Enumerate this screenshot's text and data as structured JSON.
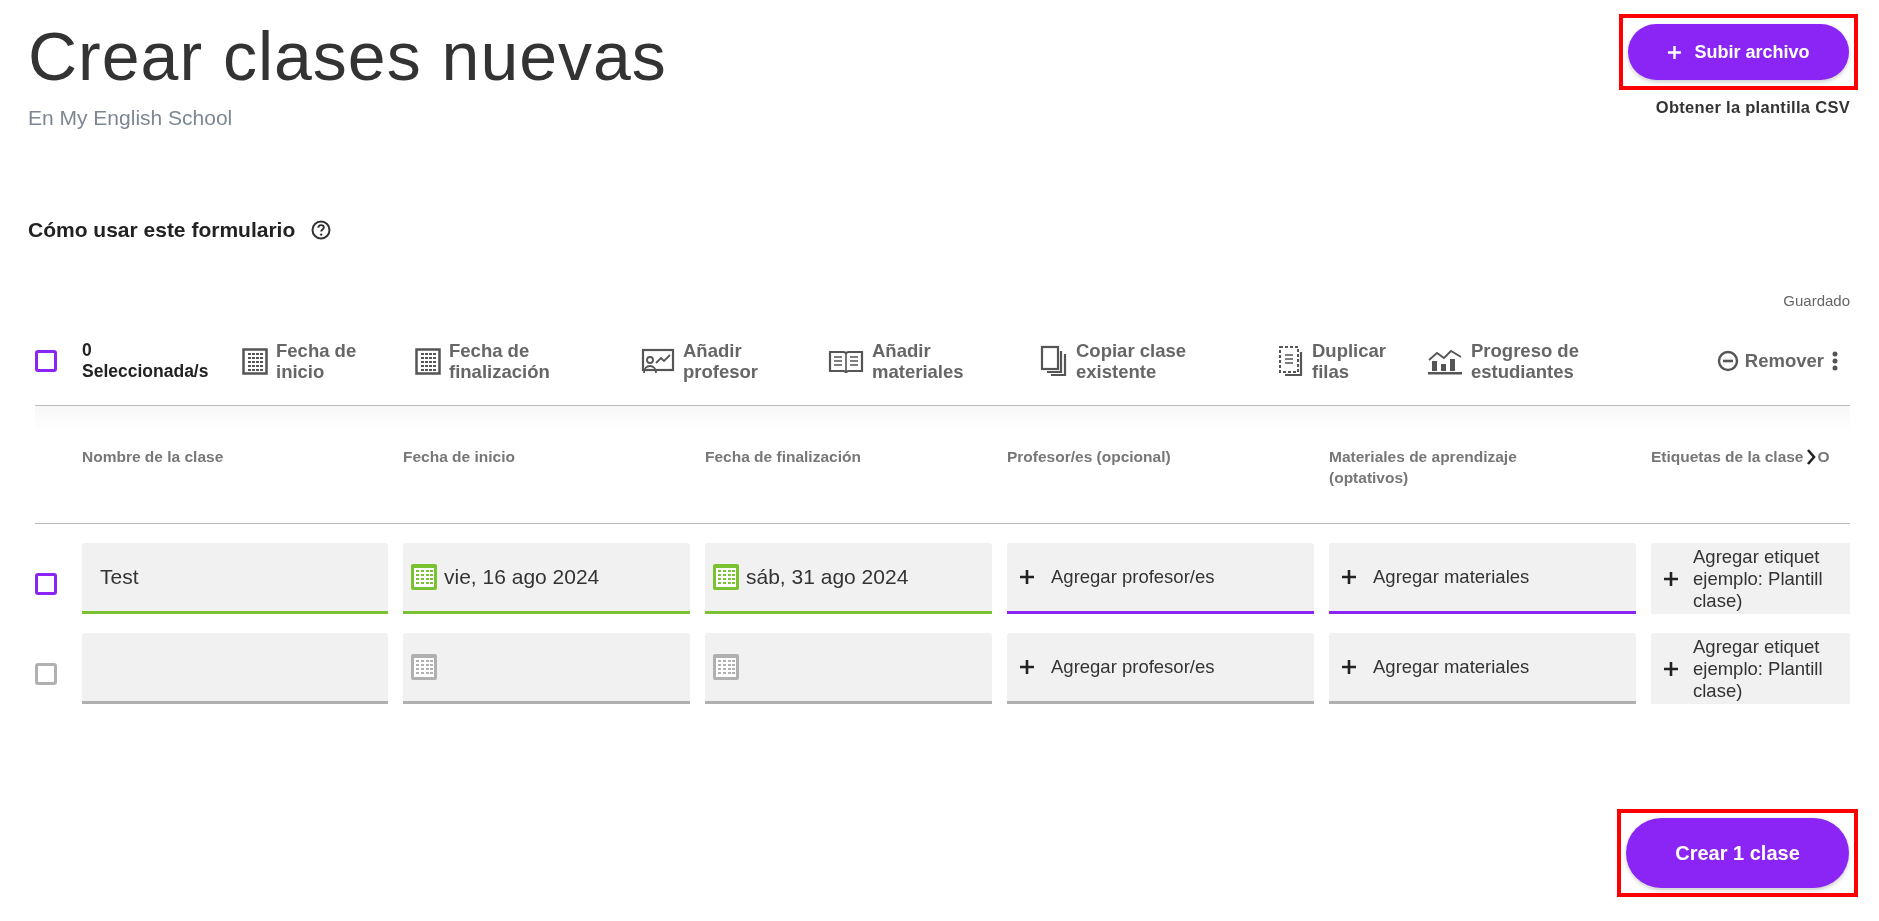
{
  "header": {
    "title": "Crear clases nuevas",
    "subtitle": "En My English School"
  },
  "upload": {
    "label": "Subir archivo",
    "highlighted": true,
    "template_link": "Obtener la plantilla CSV"
  },
  "help": {
    "label": "Cómo usar este formulario"
  },
  "save_status": "Guardado",
  "toolbar": {
    "select_all": {
      "checked": false
    },
    "count_lines": [
      "0",
      "Seleccionada/s"
    ],
    "actions": [
      {
        "kind": "calendar",
        "lines": [
          "Fecha de",
          "inicio"
        ]
      },
      {
        "kind": "calendar",
        "lines": [
          "Fecha de",
          "finalización"
        ]
      },
      {
        "kind": "teacher",
        "lines": [
          "Añadir",
          "profesor"
        ]
      },
      {
        "kind": "book",
        "lines": [
          "Añadir",
          "materiales"
        ]
      },
      {
        "kind": "copy",
        "lines": [
          "Copiar clase",
          "existente"
        ]
      },
      {
        "kind": "duplicate",
        "lines": [
          "Duplicar",
          "filas"
        ]
      },
      {
        "kind": "chart",
        "lines": [
          "Progreso de",
          "estudiantes"
        ]
      }
    ],
    "remove": {
      "label": "Remover"
    }
  },
  "table": {
    "columns": [
      "Nombre de la clase",
      "Fecha de inicio",
      "Fecha de finalización",
      "Profesor/es (opcional)",
      "Materiales de aprendizaje (optativos)",
      "Etiquetas de la clase",
      "O"
    ],
    "rows": [
      {
        "color": "#8a25f5",
        "checked": false,
        "name": {
          "value": "Test",
          "valid": true
        },
        "start": {
          "value": "vie, 16 ago 2024",
          "valid": true
        },
        "end": {
          "value": "sáb, 31 ago 2024",
          "valid": true
        },
        "teachers": {
          "label": "Agregar profesor/es",
          "focused": true
        },
        "materials": {
          "label": "Agregar materiales",
          "focused": true
        },
        "tags": {
          "lines": [
            "Agregar etiquet",
            "ejemplo: Plantill",
            "clase)"
          ]
        }
      },
      {
        "color": "#b0b0b0",
        "checked": false,
        "name": {
          "valid": false
        },
        "start": {
          "valid": false
        },
        "end": {
          "valid": false
        },
        "teachers": {
          "label": "Agregar profesor/es",
          "focused": false
        },
        "materials": {
          "label": "Agregar materiales",
          "focused": false
        },
        "tags": {
          "lines": [
            "Agregar etiquet",
            "ejemplo: Plantill",
            "clase)"
          ]
        }
      }
    ]
  },
  "create": {
    "label": "Crear 1 clase",
    "highlighted": true
  }
}
